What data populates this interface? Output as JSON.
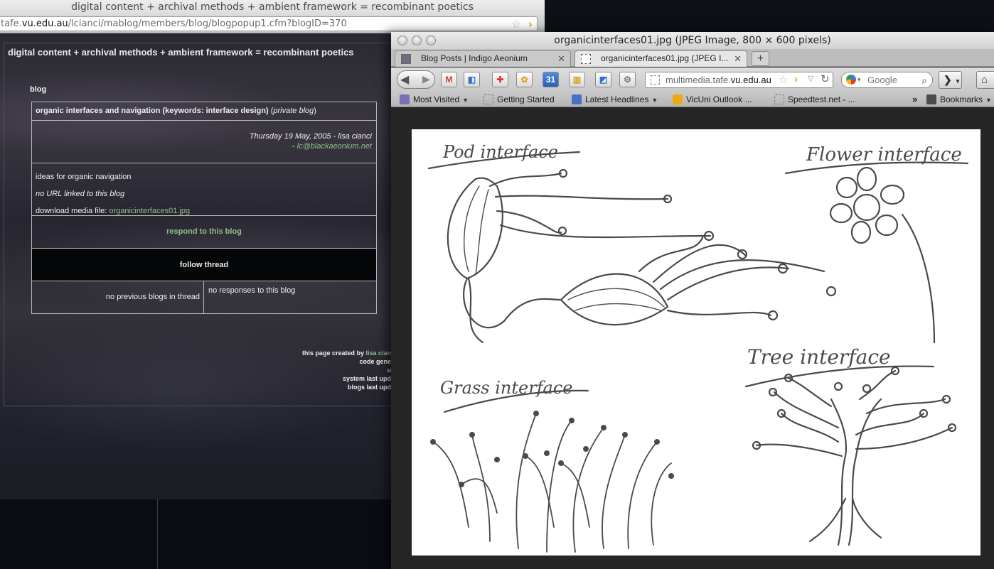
{
  "back_window": {
    "title": "digital content + archival methods + ambient framework = recombinant poetics",
    "url_prefix": "tafe.",
    "url_host": "vu.edu.au",
    "url_path": "/lcianci/mablog/members/blog/blogpopup1.cfm?blogID=370",
    "blog": {
      "page_title": "digital content + archival methods + ambient framework = recombinant poetics",
      "section_label": "blog",
      "heading": "organic interfaces and navigation (keywords: interface design)",
      "privacy_open": "(",
      "privacy_text": "private blog",
      "privacy_close": ")",
      "date_author": "Thursday 19 May, 2005 - lisa cianci",
      "email_prefix": "- ",
      "email": "lc@blackaeonium.net",
      "description": "ideas for organic navigation",
      "url_status": "no URL linked to this blog",
      "download_label": "download media file: ",
      "download_file": "organicinterfaces01.jpg",
      "respond": "respond to this blog",
      "follow": "follow thread",
      "no_previous": "no previous blogs in thread",
      "no_responses": "no responses to this blog"
    },
    "credits": {
      "line1_text": "this page created by ",
      "line1_link": "lisa cian",
      "line2": "code gene",
      "line3": "u",
      "line4": "system last upd",
      "line5": "blogs last upd"
    }
  },
  "front_window": {
    "title": "organicinterfaces01.jpg (JPEG Image, 800 × 600 pixels)",
    "tabs": [
      {
        "label": "Blog Posts | Indigo Aeonium",
        "active": false
      },
      {
        "label": "organicinterfaces01.jpg (JPEG I...",
        "active": true
      }
    ],
    "new_tab": "+",
    "url_host_prefix": "multimedia.tafe.",
    "url_host": "vu.edu.au",
    "search_placeholder": "Google",
    "toolbar_calendar_label": "31",
    "bookmarks": [
      {
        "label": "Most Visited",
        "dropdown": true
      },
      {
        "label": "Getting Started",
        "dropdown": false
      },
      {
        "label": "Latest Headlines",
        "dropdown": true
      },
      {
        "label": "VicUni Outlook ...",
        "dropdown": false
      },
      {
        "label": "Speedtest.net - ...",
        "dropdown": false
      }
    ],
    "bookmarks_overflow": "»",
    "bookmarks_menu": "Bookmarks",
    "sketch_labels": {
      "pod": "Pod interface",
      "flower": "Flower interface",
      "grass": "Grass interface",
      "tree": "Tree interface"
    }
  },
  "colors": {
    "link_green": "#8fbf8c",
    "rss_orange": "#e0a21e",
    "sketch_ink": "#4a4a4a"
  }
}
